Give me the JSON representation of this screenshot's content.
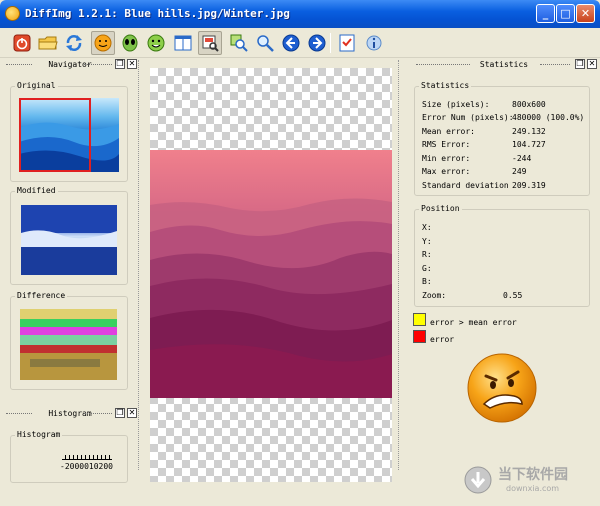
{
  "window": {
    "title": "DiffImg 1.2.1: Blue hills.jpg/Winter.jpg"
  },
  "navigator": {
    "title": "Navigator",
    "original_label": "Original",
    "modified_label": "Modified",
    "difference_label": "Difference"
  },
  "histogram": {
    "title": "Histogram",
    "label": "Histogram",
    "scale": "-2000010200"
  },
  "statistics": {
    "title": "Statistics",
    "group_label": "Statistics",
    "rows": [
      {
        "label": "Size (pixels):",
        "value": "800x600"
      },
      {
        "label": "Error Num (pixels):",
        "value": "480000 (100.0%)"
      },
      {
        "label": "Mean error:",
        "value": "249.132"
      },
      {
        "label": "RMS Error:",
        "value": "104.727"
      },
      {
        "label": "Min error:",
        "value": "-244"
      },
      {
        "label": "Max error:",
        "value": "249"
      },
      {
        "label": "Standard deviation",
        "value": "209.319"
      }
    ]
  },
  "position": {
    "group_label": "Position",
    "rows": [
      {
        "label": "X:",
        "value": ""
      },
      {
        "label": "Y:",
        "value": ""
      },
      {
        "label": "R:",
        "value": ""
      },
      {
        "label": "G:",
        "value": ""
      },
      {
        "label": "B:",
        "value": ""
      },
      {
        "label": "Zoom:",
        "value": "0.55"
      }
    ]
  },
  "legend": {
    "mean_error": "error > mean error",
    "error": "error",
    "mean_error_color": "#ffff00",
    "error_color": "#ff0000"
  },
  "watermark": {
    "text": "当下软件园",
    "url": "downxia.com"
  },
  "colors": {
    "titlebar": "#0553d3",
    "face_icon": "#f7a418"
  }
}
